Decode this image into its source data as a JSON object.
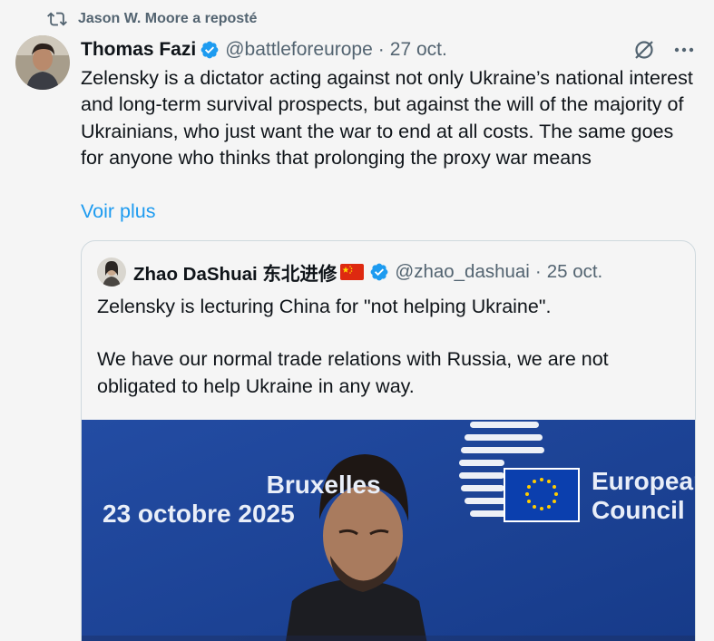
{
  "repost": {
    "text": "Jason W. Moore a reposté",
    "icon": "repost-icon"
  },
  "tweet": {
    "author_name": "Thomas Fazi",
    "handle": "@battleforeurope",
    "separator": "·",
    "date": "27 oct.",
    "text": "Zelensky is a dictator acting against not only Ukraine’s national interest and long-term survival prospects, but against the will of the majority of Ukrainians, who just want the war to end at all costs. The same goes for anyone who thinks that prolonging the proxy war means",
    "read_more": "Voir plus",
    "verified_color": "#1d9bf0"
  },
  "quote": {
    "author_name": "Zhao DaShuai 东北进修",
    "handle": "@zhao_dashuai",
    "separator": "·",
    "date": "25 oct.",
    "text_p1": "Zelensky is lecturing China for \"not helping Ukraine\".",
    "text_p2": "We have our normal trade relations with Russia, we are not obligated to help Ukraine in any way.",
    "media": {
      "city_line1": "Bruxelles",
      "city_line2": "23 octobre 2025",
      "org_line1": "European",
      "org_line2": "Council",
      "background": "#1a3f91"
    }
  },
  "colors": {
    "link": "#1d9bf0",
    "muted": "#536471",
    "text": "#0f1419",
    "background": "#f5f5f5"
  }
}
